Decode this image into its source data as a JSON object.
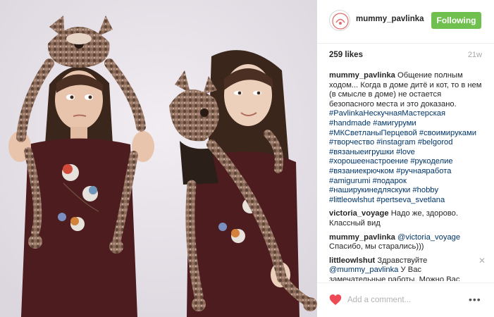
{
  "header": {
    "username": "mummy_pavlinka",
    "follow_label": "Following",
    "avatar_icon": "logo-avatar-icon"
  },
  "stats": {
    "likes": "259 likes",
    "age": "21w"
  },
  "caption": {
    "user": "mummy_pavlinka",
    "text": "Общение полным ходом... Когда в доме дитё и кот, то в нем (в смысле в доме) не остается безопасного места и это доказано.",
    "hashtags": [
      "#PavlinkaНескучнаяМастерская",
      "#handmade",
      "#амигуруми",
      "#МКСветланыПерцевой",
      "#своимируками",
      "#творчество",
      "#instagram",
      "#belgorod",
      "#вязаныеигрушки",
      "#love",
      "#хорошеенастроение",
      "#рукоделие",
      "#вязаниекрючком",
      "#ручнаяработа",
      "#amigurumi",
      "#подарок",
      "#наширукинедляскуки",
      "#hobby",
      "#littleowlshut",
      "#pertseva_svetlana"
    ]
  },
  "comments": [
    {
      "user": "victoria_voyage",
      "text": "Надо же, здорово. Классный вид"
    },
    {
      "user": "mummy_pavlinka",
      "mention": "@victoria_voyage",
      "text": "Спасибо, мы старались)))"
    },
    {
      "user": "littleowlshut",
      "text": "Здравствуйте",
      "mention": "@mummy_pavlinka",
      "text2": "У Вас замечательные работы. Можно Вас попросить",
      "close": "✕"
    }
  ],
  "footer": {
    "placeholder": "Add a comment...",
    "more": "•••"
  },
  "colors": {
    "accent_green": "#70c050",
    "link_blue": "#003569",
    "heart_red": "#ed4956"
  }
}
